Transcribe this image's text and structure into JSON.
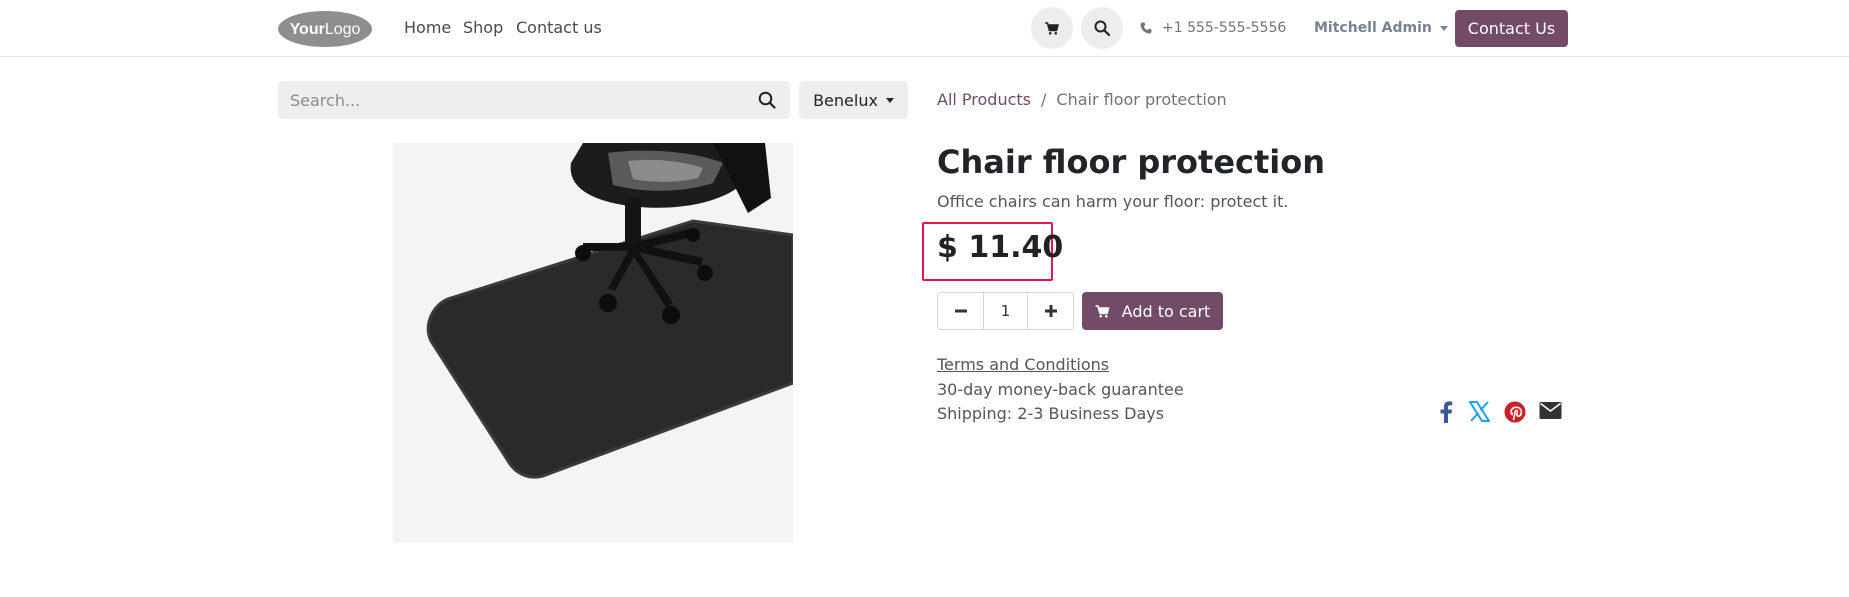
{
  "brand": {
    "logo_text": "YourLogo",
    "accent": "#714b67"
  },
  "nav": {
    "items": [
      {
        "label": "Home"
      },
      {
        "label": "Shop"
      },
      {
        "label": "Contact us"
      }
    ],
    "phone": "+1 555-555-5556",
    "user": "Mitchell Admin",
    "contact_button": "Contact Us"
  },
  "search": {
    "placeholder": "Search...",
    "value": ""
  },
  "region": {
    "selected": "Benelux"
  },
  "breadcrumb": {
    "parent": "All Products",
    "separator": "/",
    "current": "Chair floor protection"
  },
  "product": {
    "name": "Chair floor protection",
    "description": "Office chairs can harm your floor: protect it.",
    "price": "$ 11.40",
    "quantity": "1",
    "add_to_cart": "Add to cart",
    "terms": "Terms and Conditions",
    "guarantee": "30-day money-back guarantee",
    "shipping": "Shipping: 2-3 Business Days"
  },
  "share_icons": [
    "facebook-icon",
    "x-twitter-icon",
    "pinterest-icon",
    "email-icon"
  ],
  "colors": {
    "highlight": "#e2184a",
    "facebook": "#3b5998",
    "twitter": "#1da1f2",
    "pinterest": "#cb2027",
    "email": "#333333"
  }
}
